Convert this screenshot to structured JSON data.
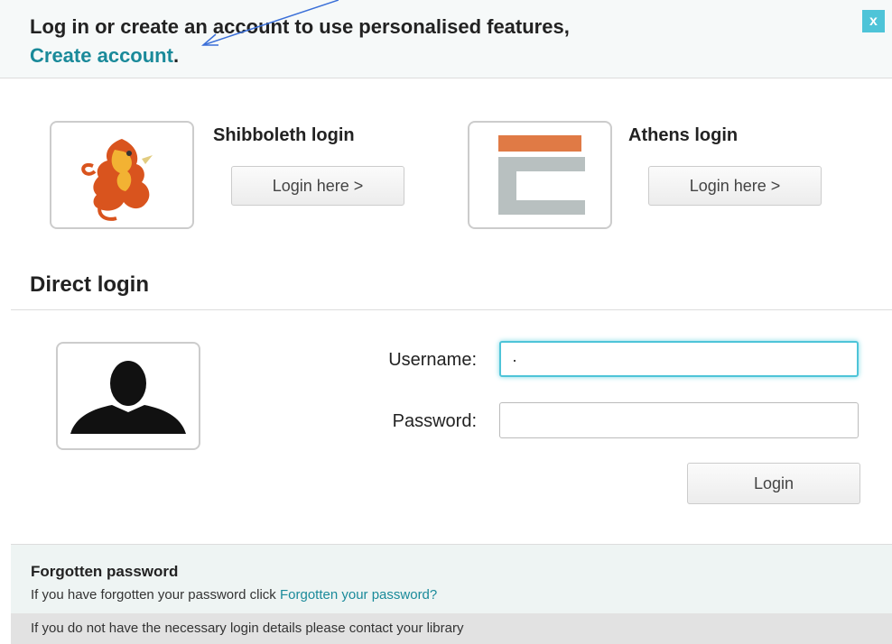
{
  "header": {
    "prompt": "Log in or create an account to use personalised features,",
    "create_account": "Create account",
    "punct": ".",
    "close_label": "x"
  },
  "shibboleth": {
    "title": "Shibboleth login",
    "button": "Login here >"
  },
  "athens": {
    "title": "Athens login",
    "button": "Login here >"
  },
  "direct": {
    "title": "Direct login",
    "username_label": "Username:",
    "username_value": "·",
    "password_label": "Password:",
    "password_value": "",
    "login_button": "Login"
  },
  "forgot": {
    "title": "Forgotten password",
    "text": "If you have forgotten your password click ",
    "link": "Forgotten your password?"
  },
  "footer": {
    "text": "If you do not have the necessary login details please contact your library"
  },
  "colors": {
    "accent": "#4ec4d8",
    "link": "#1a8a9a",
    "athens_orange": "#e07a45",
    "athens_gray": "#b8c0c0"
  }
}
